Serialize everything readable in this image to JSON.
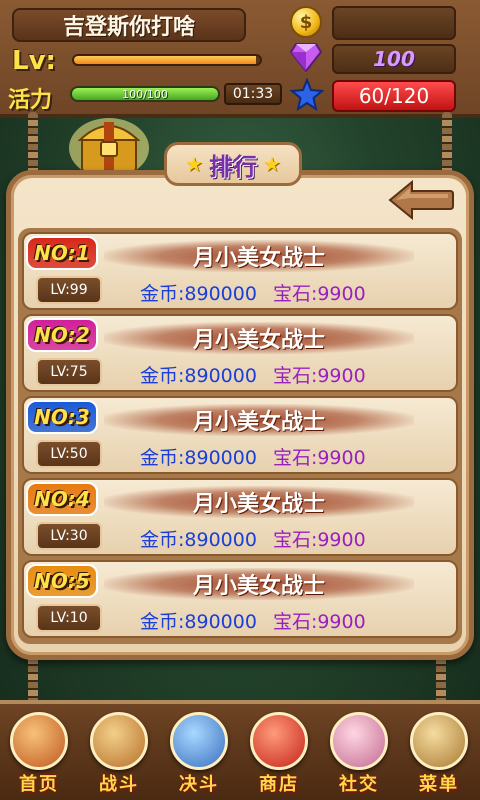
{
  "player": {
    "name": "吉登斯你打啥",
    "lv_label": "Lv:",
    "xp_fraction": 0.98
  },
  "vitality": {
    "label": "活力",
    "text": "100/100",
    "fraction": 1.0,
    "timer": "01:33"
  },
  "currency": {
    "coins": "",
    "gems": "100",
    "stars": "60/120"
  },
  "title": {
    "text": "排行"
  },
  "ranking": [
    {
      "rank": "NO:1",
      "level": "LV:99",
      "name": "月小美女战士",
      "gold": "金币:890000",
      "gem": "宝石:9900",
      "color": "#d8281a"
    },
    {
      "rank": "NO:2",
      "level": "LV:75",
      "name": "月小美女战士",
      "gold": "金币:890000",
      "gem": "宝石:9900",
      "color": "#d21f9a"
    },
    {
      "rank": "NO:3",
      "level": "LV:50",
      "name": "月小美女战士",
      "gold": "金币:890000",
      "gem": "宝石:9900",
      "color": "#1a5ad8"
    },
    {
      "rank": "NO:4",
      "level": "LV:30",
      "name": "月小美女战士",
      "gold": "金币:890000",
      "gem": "宝石:9900",
      "color": "#e87a10"
    },
    {
      "rank": "NO:5",
      "level": "LV:10",
      "name": "月小美女战士",
      "gold": "金币:890000",
      "gem": "宝石:9900",
      "color": "#e88c10"
    }
  ],
  "nav": [
    {
      "label": "首页",
      "icon": "home-icon"
    },
    {
      "label": "战斗",
      "icon": "battle-icon"
    },
    {
      "label": "决斗",
      "icon": "duel-icon"
    },
    {
      "label": "商店",
      "icon": "shop-icon"
    },
    {
      "label": "社交",
      "icon": "social-icon"
    },
    {
      "label": "菜单",
      "icon": "menu-icon"
    }
  ]
}
